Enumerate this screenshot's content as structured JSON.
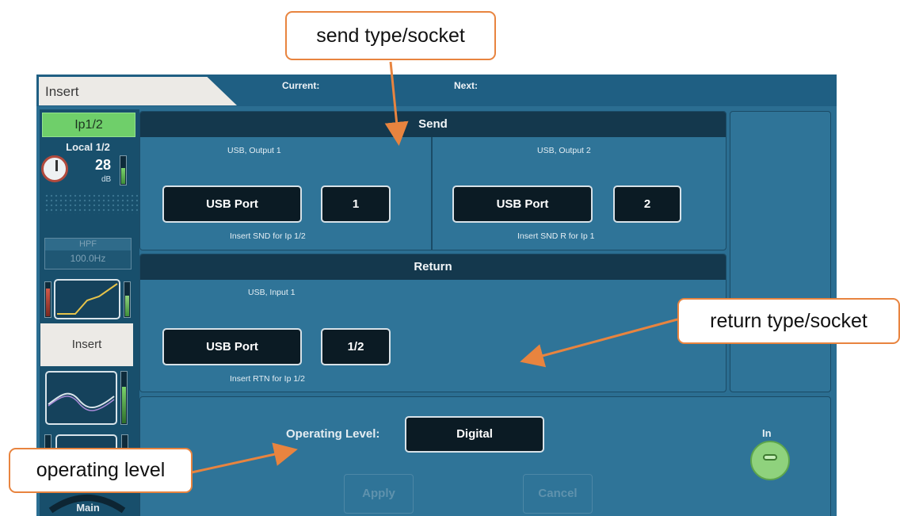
{
  "header": {
    "tab_label": "Insert",
    "current_label": "Current:",
    "next_label": "Next:"
  },
  "channel_strip": {
    "input_label": "Ip1/2",
    "source_label": "Local 1/2",
    "gain_value": "28",
    "gain_unit": "dB",
    "hpf_title": "HPF",
    "hpf_freq": "100.0Hz",
    "insert_label": "Insert",
    "main_label": "Main"
  },
  "send": {
    "heading": "Send",
    "left": {
      "destination": "USB, Output 1",
      "type_button": "USB Port",
      "socket_button": "1",
      "caption": "Insert SND for Ip 1/2"
    },
    "right": {
      "destination": "USB, Output 2",
      "type_button": "USB Port",
      "socket_button": "2",
      "caption": "Insert SND R for Ip 1"
    }
  },
  "return": {
    "heading": "Return",
    "source": "USB, Input 1",
    "type_button": "USB Port",
    "socket_button": "1/2",
    "caption": "Insert RTN for Ip 1/2"
  },
  "operating": {
    "label": "Operating Level:",
    "value": "Digital",
    "apply_label": "Apply",
    "cancel_label": "Cancel",
    "in_label": "In"
  },
  "callouts": {
    "send": "send type/socket",
    "return": "return type/socket",
    "operating": "operating level"
  },
  "colors": {
    "accent": "#e8843f",
    "screen_bg": "#2b6e92",
    "panel_header": "#14384d",
    "active_green": "#6fcf6a"
  }
}
